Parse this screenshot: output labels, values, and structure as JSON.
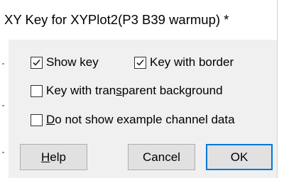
{
  "window": {
    "title": "XY Key for XYPlot2(P3 B39 warmup) *"
  },
  "options": {
    "show_key": {
      "label": "Show key",
      "checked": true
    },
    "key_with_border": {
      "label": "Key with border",
      "checked": true
    },
    "transparent_background": {
      "label_prefix": "Key with tran",
      "label_underline": "s",
      "label_suffix": "parent background",
      "checked": false
    },
    "no_example_data": {
      "label_prefix": "",
      "label_underline": "D",
      "label_suffix": "o not show example channel data",
      "checked": false
    }
  },
  "buttons": {
    "help": {
      "label_underline": "H",
      "label_rest": "elp"
    },
    "cancel": {
      "label": "Cancel"
    },
    "ok": {
      "label": "OK"
    }
  },
  "colors": {
    "accent": "#0078d7",
    "dialog_bg": "#f0f0f0",
    "button_bg": "#e1e1e1"
  }
}
